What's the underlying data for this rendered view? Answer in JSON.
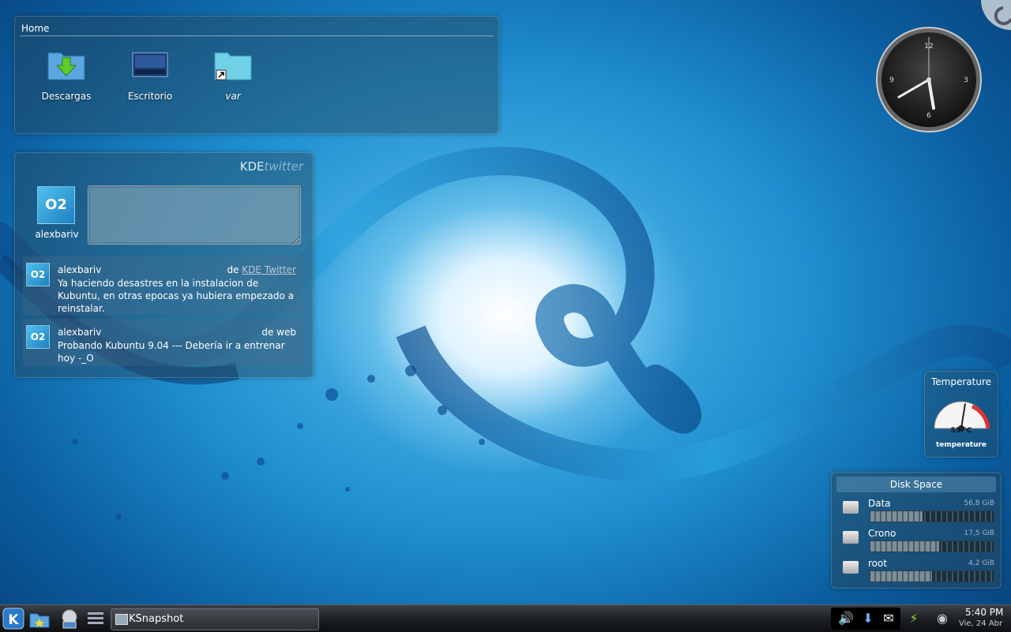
{
  "home": {
    "title": "Home",
    "icons": [
      {
        "label": "Descargas",
        "icon": "downloads-folder-icon"
      },
      {
        "label": "Escritorio",
        "icon": "desktop-folder-icon"
      },
      {
        "label": "var",
        "icon": "folder-link-icon"
      }
    ]
  },
  "twitter": {
    "brand_kde": "KDE",
    "brand_twitter": "twitter",
    "me": {
      "name": "alexbariv",
      "avatar": "O2"
    },
    "tweets": [
      {
        "user": "alexbariv",
        "avatar": "O2",
        "source_prefix": "de",
        "source": "KDE Twitter",
        "text": "Ya haciendo desastres en la instalacion de Kubuntu, en otras epocas ya hubiera empezado a reinstalar."
      },
      {
        "user": "alexbariv",
        "avatar": "O2",
        "source_prefix": "de",
        "source": "web",
        "text": "Probando Kubuntu 9.04 --- Debería ir a entrenar hoy -_O"
      }
    ]
  },
  "clock_widget": {
    "numerals": [
      "12",
      "3",
      "6",
      "9"
    ]
  },
  "temperature": {
    "title": "Temperature",
    "value": "55 °C",
    "caption": "temperature",
    "level_fraction": 0.55
  },
  "disk_space": {
    "title": "Disk Space",
    "drives": [
      {
        "name": "Data",
        "size": "56,8 GiB",
        "used_fraction": 0.42
      },
      {
        "name": "Crono",
        "size": "17,5 GiB",
        "used_fraction": 0.56
      },
      {
        "name": "root",
        "size": "4,2 GiB",
        "used_fraction": 0.5
      }
    ]
  },
  "taskbar": {
    "task": "KSnapshot",
    "time": "5:40 PM",
    "date": "Vie, 24 Abr"
  },
  "colors": {
    "accent": "#1f8fd0",
    "panel": "#28465a"
  }
}
